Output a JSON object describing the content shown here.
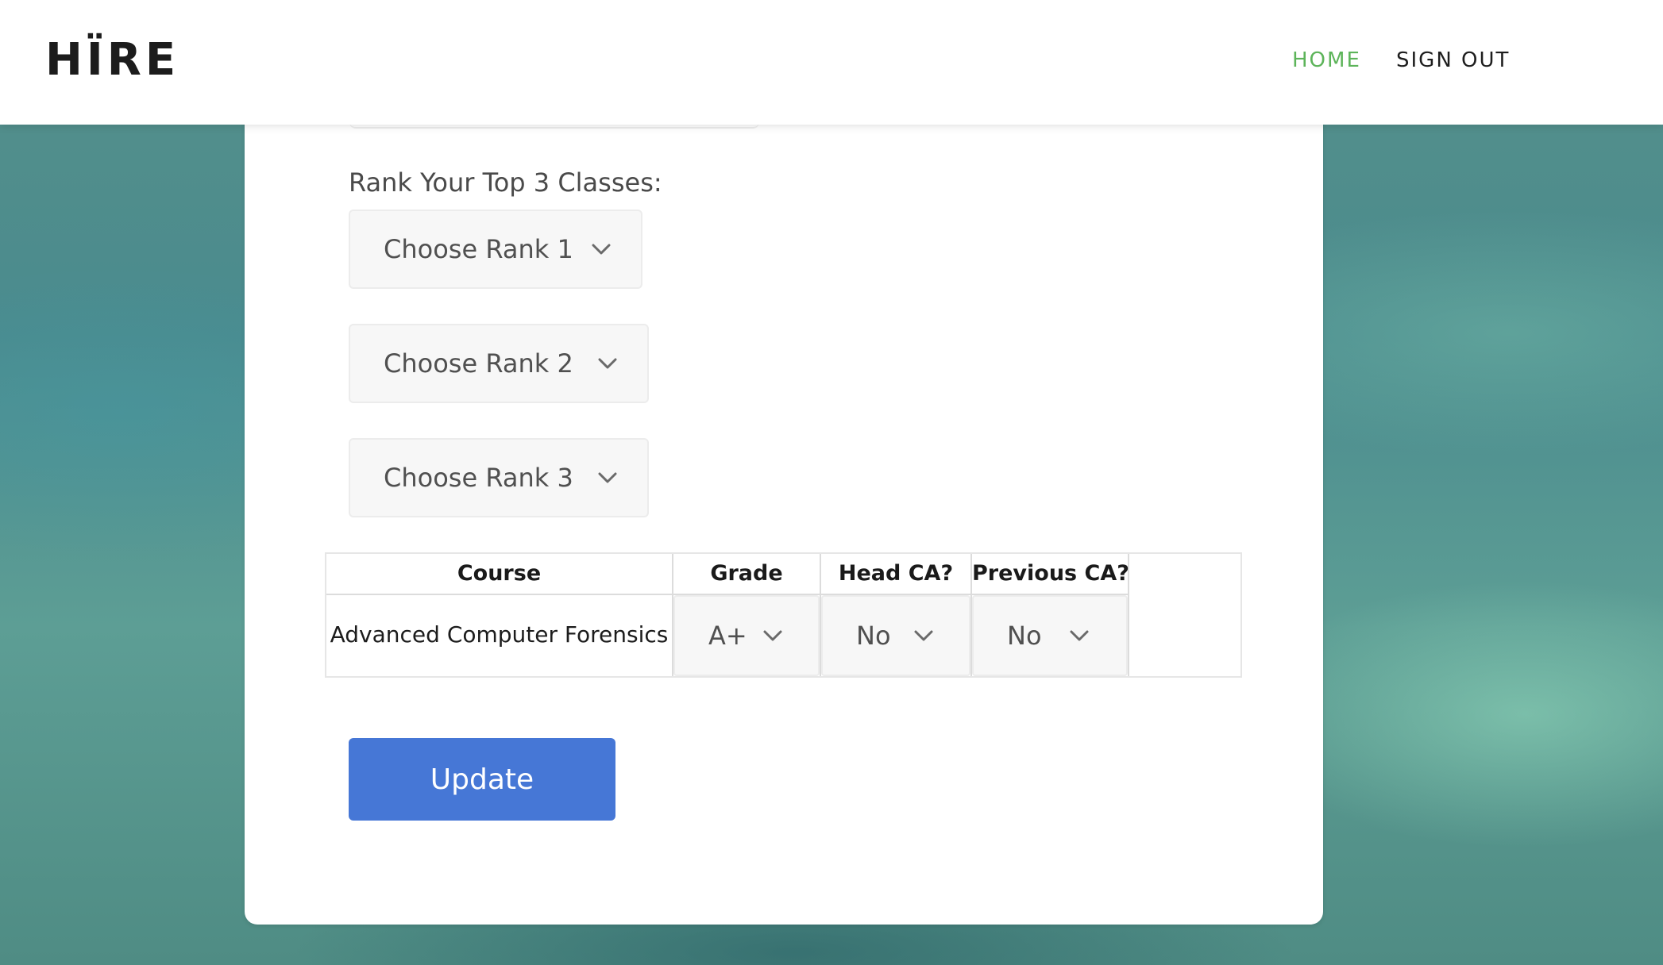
{
  "header": {
    "logo": "HÏRE",
    "nav": [
      {
        "label": "HOME",
        "active": true,
        "color": "#5db45a"
      },
      {
        "label": "SIGN OUT",
        "active": false,
        "color": "#1e1e1e"
      }
    ]
  },
  "form": {
    "rank_label": "Rank Your Top 3 Classes:",
    "rank_selects": [
      {
        "value": "Choose Rank 1"
      },
      {
        "value": "Choose Rank 2"
      },
      {
        "value": "Choose Rank 3"
      }
    ]
  },
  "table": {
    "headers": [
      "Course",
      "Grade",
      "Head CA?",
      "Previous CA?"
    ],
    "rows": [
      {
        "course": "Advanced Computer Forensics",
        "grade": "A+",
        "head_ca": "No",
        "previous_ca": "No"
      }
    ]
  },
  "update_button": {
    "label": "Update",
    "color": "#4677d6"
  },
  "icons": {
    "select_arrow": "chevron-down-icon"
  }
}
